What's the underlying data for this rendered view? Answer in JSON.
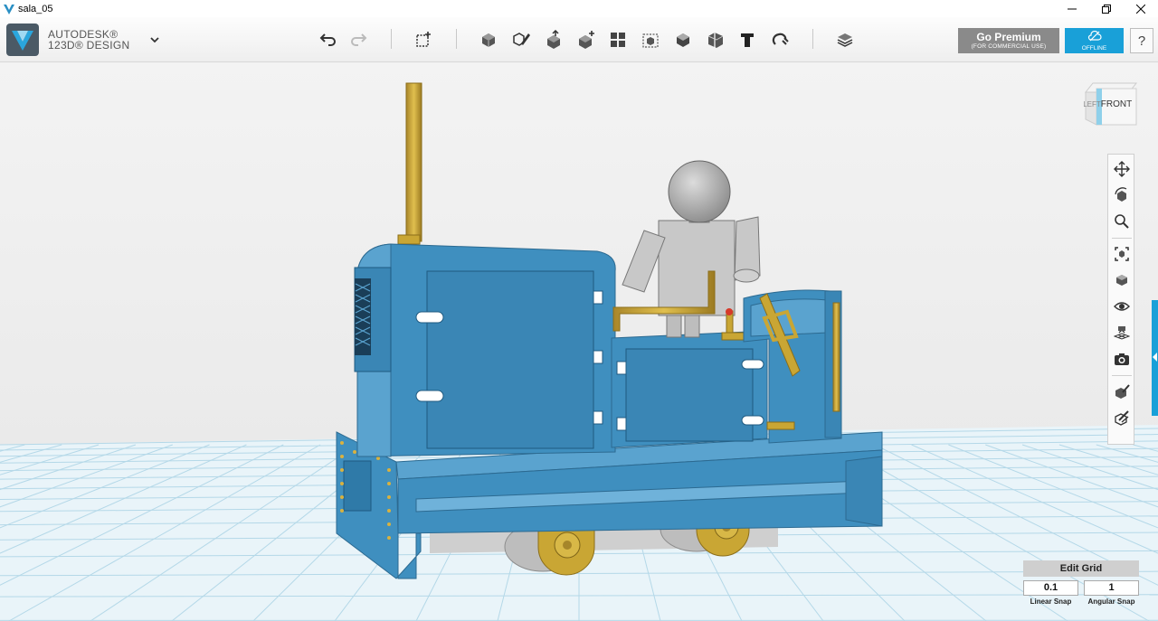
{
  "window": {
    "title": "sala_05",
    "controls": [
      "minimize-icon",
      "restore-icon",
      "close-icon"
    ]
  },
  "brand": {
    "line1": "AUTODESK®",
    "line2": "123D® DESIGN",
    "menu_icon": "chevron-down-icon"
  },
  "toolbar": {
    "tools": [
      "undo-icon",
      "redo-icon",
      "transform-icon",
      "primitives-icon",
      "sketch-icon",
      "construct-icon",
      "modify-icon",
      "pattern-icon",
      "grouping-icon",
      "combine-icon",
      "measure-icon",
      "text-icon",
      "snap-icon",
      "material-icon"
    ]
  },
  "premium": {
    "label": "Go Premium",
    "sublabel": "(FOR COMMERCIAL USE)"
  },
  "offline": {
    "label": "OFFLINE",
    "icon": "cloud-offline-icon"
  },
  "help": {
    "label": "?"
  },
  "viewcube": {
    "front": "FRONT",
    "left": "LEFT"
  },
  "navbar": {
    "items": [
      "pan-icon",
      "orbit-icon",
      "zoom-icon",
      "fit-icon",
      "view-options-icon",
      "visibility-icon",
      "grid-icon",
      "screenshot-icon",
      "material-display-icon",
      "snap-display-icon"
    ]
  },
  "edit_grid": {
    "button": "Edit Grid",
    "linear_snap_value": "0.1",
    "angular_snap_value": "1",
    "linear_snap_label": "Linear Snap",
    "angular_snap_label": "Angular Snap"
  },
  "colors": {
    "accent": "#19a0d8",
    "body_blue": "#3f8fbf",
    "brass": "#c9a634",
    "grid_line": "#a9d3e6"
  }
}
